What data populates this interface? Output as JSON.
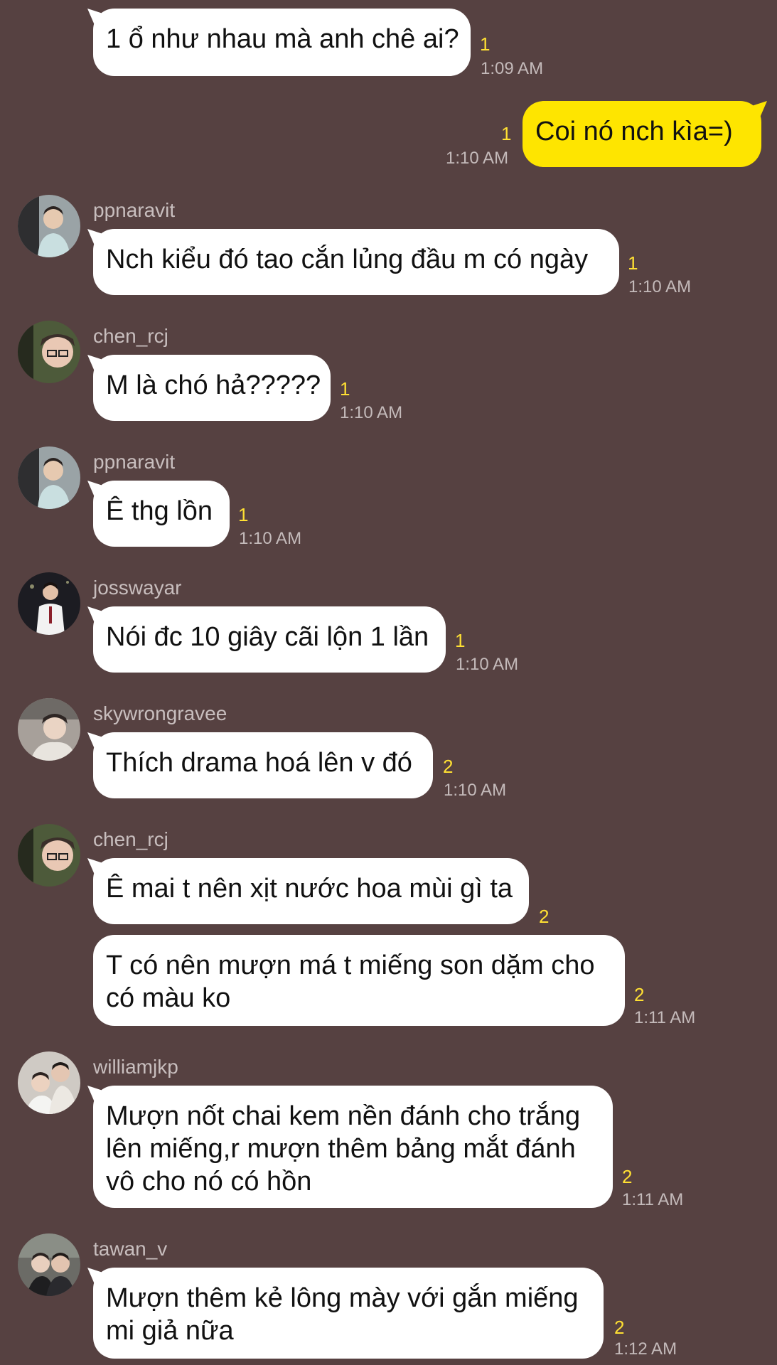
{
  "messages": [
    {
      "type": "in",
      "sender": "",
      "text": "1 ổ như nhau mà anh chê ai?",
      "unread": "1",
      "time": "1:09 AM"
    },
    {
      "type": "out",
      "text": "Coi nó nch kìa=)",
      "unread": "1",
      "time": "1:10 AM"
    },
    {
      "type": "in",
      "sender": "ppnaravit",
      "text": "Nch kiểu đó tao cắn lủng đầu m có ngày",
      "unread": "1",
      "time": "1:10 AM"
    },
    {
      "type": "in",
      "sender": "chen_rcj",
      "text": "M là chó hả?????",
      "unread": "1",
      "time": "1:10 AM"
    },
    {
      "type": "in",
      "sender": "ppnaravit",
      "text": "Ê thg lồn",
      "unread": "1",
      "time": "1:10 AM"
    },
    {
      "type": "in",
      "sender": "josswayar",
      "text": "Nói đc 10 giây cãi lộn 1 lần",
      "unread": "1",
      "time": "1:10 AM"
    },
    {
      "type": "in",
      "sender": "skywrongravee",
      "text": "Thích drama hoá lên v đó",
      "unread": "2",
      "time": "1:10 AM"
    },
    {
      "type": "in",
      "sender": "chen_rcj",
      "text": "Ê mai t nên xịt nước hoa mùi gì ta",
      "unread": "2",
      "time": ""
    },
    {
      "type": "in",
      "sender": "",
      "text_lines": [
        "T có nên mượn má t miếng son dặm cho",
        "có màu ko"
      ],
      "unread": "2",
      "time": "1:11 AM"
    },
    {
      "type": "in",
      "sender": "williamjkp",
      "text_lines": [
        "Mượn nốt chai kem nền đánh cho trắng",
        "lên miếng,r mượn thêm bảng mắt đánh",
        "vô cho nó có hồn"
      ],
      "unread": "2",
      "time": "1:11 AM"
    },
    {
      "type": "in",
      "sender": "tawan_v",
      "text_lines": [
        "Mượn thêm kẻ lông mày với gắn miếng",
        "mi giả nữa"
      ],
      "unread": "2",
      "time": "1:12 AM"
    }
  ],
  "avatars": [
    {
      "user": "ppnaravit",
      "icon": "avatar-photo",
      "bg": "#9aa3a6"
    },
    {
      "user": "chen_rcj",
      "icon": "avatar-photo",
      "bg": "#4d5a3a"
    },
    {
      "user": "josswayar",
      "icon": "avatar-photo",
      "bg": "#1c1c22"
    },
    {
      "user": "skywrongravee",
      "icon": "avatar-photo",
      "bg": "#a7a09a"
    },
    {
      "user": "williamjkp",
      "icon": "avatar-photo",
      "bg": "#cfcac4"
    },
    {
      "user": "tawan_v",
      "icon": "avatar-photo",
      "bg": "#6b6b66"
    }
  ],
  "colors": {
    "background": "#564141",
    "incoming_bubble": "#ffffff",
    "outgoing_bubble": "#fee500",
    "unread": "#ffe033",
    "time": "#c4baba"
  }
}
